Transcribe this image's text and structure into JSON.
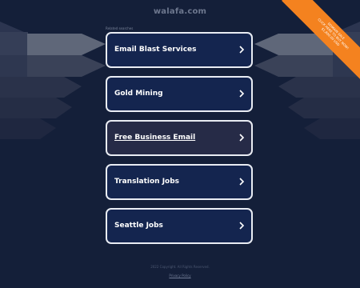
{
  "header": {
    "domain": "walafa.com"
  },
  "related": {
    "label": "Related searches",
    "items": [
      {
        "label": "Email Blast Services",
        "visited": false
      },
      {
        "label": "Gold Mining",
        "visited": false
      },
      {
        "label": "Free Business Email",
        "visited": true
      },
      {
        "label": "Translation Jobs",
        "visited": false
      },
      {
        "label": "Seattle Jobs",
        "visited": false
      }
    ]
  },
  "footer": {
    "copyright": "2022 Copyright. All Rights Reserved.",
    "privacy": "Privacy Policy"
  },
  "sale_ribbon": {
    "line1": "DOMAIN SALE",
    "line2": "CLICK HERE TO BUY NOW!",
    "line3": "$1,800.00 USD"
  },
  "colors": {
    "background": "#141f39",
    "button_bg": "#14254f",
    "button_visited_bg": "#262b47",
    "button_border": "#e9ecf3",
    "ribbon": "#f4821f"
  }
}
